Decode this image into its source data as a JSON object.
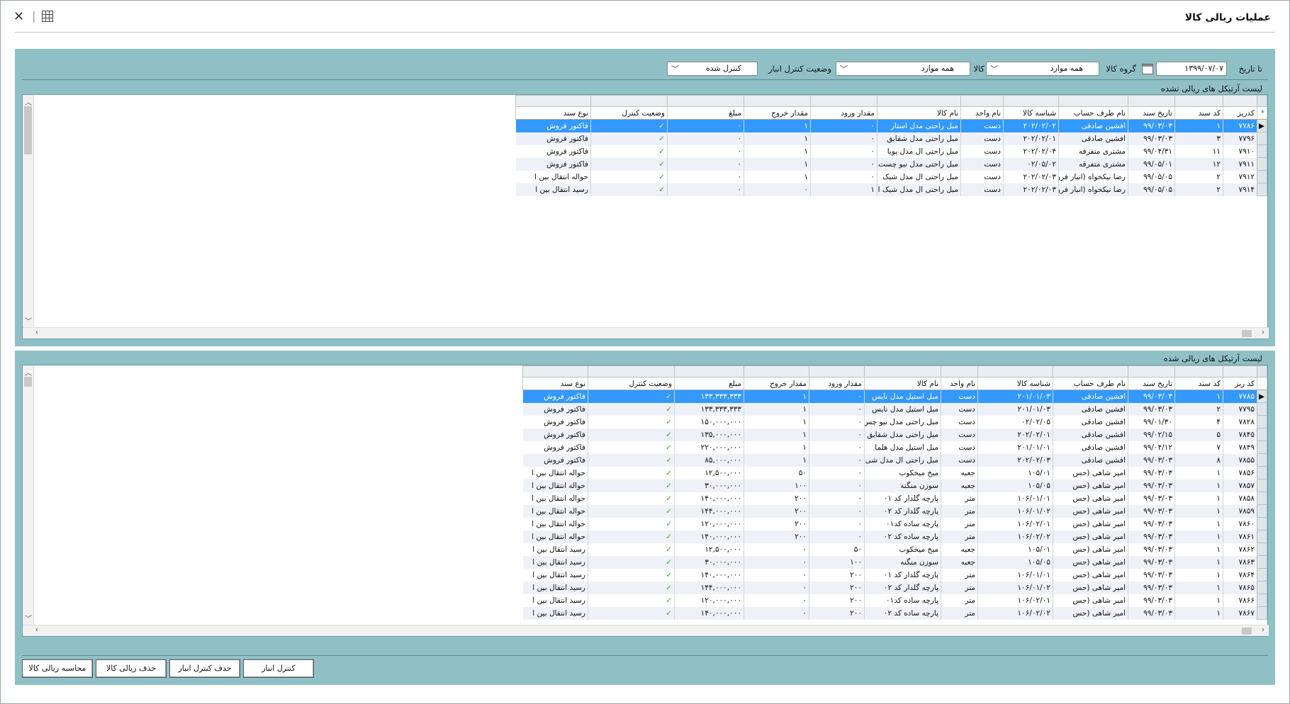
{
  "window": {
    "title": "عملیات ریالی کالا"
  },
  "filters": {
    "to_date_label": "تا تاریخ",
    "to_date_value": "۱۳۹۹/۰۷/۰۷",
    "group_label": "گروه کالا",
    "group_value": "همه موارد",
    "item_label": "کالا",
    "item_value": "همه موارد",
    "status_label": "وضعیت کنترل انبار",
    "status_value": "کنترل شده"
  },
  "top_grid": {
    "title": "لیست آرتیکل های ریالی نشده",
    "columns": [
      "کدریز",
      "کد سند",
      "تاریخ سند",
      "نام طرف حساب",
      "شناسه کالا",
      "نام واحد",
      "نام کالا",
      "مقدار ورود",
      "مقدار خروج",
      "مبلغ",
      "وضعیت کنترل",
      "نوع سند"
    ],
    "rows": [
      [
        "۷۷۸۶",
        "۱",
        "۹۹/۰۳/۰۳",
        "افشین صادقی",
        "۲۰۲/۰۲/۰۲",
        "دست",
        "مبل راحتی مدل استار",
        "۰",
        "۱",
        "۰",
        "✓",
        "فاکتور فروش"
      ],
      [
        "۷۷۹۶",
        "۳",
        "۹۹/۰۳/۰۳",
        "افشین صادقی",
        "۲۰۲/۰۲/۰۱",
        "دست",
        "مبل راحتی مدل شقایق",
        "۰",
        "۱",
        "۰",
        "✓",
        "فاکتور فروش"
      ],
      [
        "۷۹۱۰",
        "۱۱",
        "۹۹/۰۴/۳۱",
        "مشتری متفرقه",
        "۲۰۲/۰۲/۰۴",
        "دست",
        "مبل راحتی ال مدل پویا",
        "۰",
        "۱",
        "۰",
        "✓",
        "فاکتور فروش"
      ],
      [
        "۷۹۱۱",
        "۱۲",
        "۹۹/۰۵/۰۱",
        "مشتری متفرقه",
        "۰۲/۰۵/۰۲",
        "دست",
        "مبل راحتی مدل نیو چست",
        "۰",
        "۱",
        "۰",
        "✓",
        "فاکتور فروش"
      ],
      [
        "۷۹۱۲",
        "۲",
        "۹۹/۰۵/۰۵",
        "رضا نیکخواه (انبار فرو",
        "۲۰۲/۰۲/۰۳",
        "دست",
        "مبل راحتی ال مدل شیک",
        "۰",
        "۱",
        "۰",
        "✓",
        "حواله انتقال بین ا"
      ],
      [
        "۷۹۱۴",
        "۲",
        "۹۹/۰۵/۰۵",
        "رضا نیکخواه (انبار فرو",
        "۲۰۲/۰۲/۰۳",
        "دست",
        "مبل راحتی ال مدل شیک ا",
        "۱",
        "۰",
        "۰",
        "✓",
        "رسید انتقال بین ا"
      ]
    ]
  },
  "bottom_grid": {
    "title": "لیست آرتیکل های ریالی شده",
    "columns": [
      "کد ریز",
      "کد سند",
      "تاریخ سند",
      "نام طرف حساب",
      "شناسه کالا",
      "نام واحد",
      "نام کالا",
      "مقدار ورود",
      "مقدار خروج",
      "مبلغ",
      "وضعیت کنترل",
      "نوع سند"
    ],
    "rows": [
      [
        "۷۷۸۵",
        "۱",
        "۹۹/۰۳/۰۳",
        "افشین صادقی",
        "۲۰۱/۰۱/۰۳",
        "دست",
        "مبل استیل مدل نایس",
        "۰",
        "۱",
        "۱۳۳,۳۳۳,۳۳۳",
        "✓",
        "فاکتور فروش"
      ],
      [
        "۷۷۹۵",
        "۲",
        "۹۹/۰۳/۰۳",
        "افشین صادقی",
        "۲۰۱/۰۱/۰۳",
        "دست",
        "مبل استیل مدل نایس",
        "۰",
        "۱",
        "۱۳۳,۳۳۳,۳۳۳",
        "✓",
        "فاکتور فروش"
      ],
      [
        "۷۸۲۸",
        "۴",
        "۹۹/۰۱/۳۰",
        "افشین صادقی",
        "۰۲/۰۲/۰۵",
        "دست",
        "مبل راحتی مدل نیو چس",
        "۰",
        "۱",
        "۱۵۰,۰۰۰,۰۰۰",
        "✓",
        "فاکتور فروش"
      ],
      [
        "۷۸۴۵",
        "۵",
        "۹۹/۰۲/۱۵",
        "افشین صادقی",
        "۲۰۲/۰۲/۰۱",
        "دست",
        "مبل راحتی مدل شقایق",
        "۰",
        "۱",
        "۱۳۵,۰۰۰,۰۰۰",
        "✓",
        "فاکتور فروش"
      ],
      [
        "۷۸۴۹",
        "۷",
        "۹۹/۰۴/۱۲",
        "افشین صادقی",
        "۲۰۱/۰۱/۰۱",
        "دست",
        "مبل استیل مدل هلما",
        "۰",
        "۱",
        "۲۲۰,۰۰۰,۰۰۰",
        "✓",
        "فاکتور فروش"
      ],
      [
        "۷۸۵۵",
        "۸",
        "۹۹/۰۳/۰۳",
        "افشین صادقی",
        "۲۰۲/۰۲/۰۳",
        "دست",
        "مبل راحتی ال مدل شی",
        "۰",
        "۱",
        "۸۵,۰۰۰,۰۰۰",
        "✓",
        "فاکتور فروش"
      ],
      [
        "۷۸۵۶",
        "۱",
        "۹۹/۰۳/۰۳",
        "امیر شاهی (حس",
        "۱۰۵/۰۱",
        "جعبه",
        "میخ میخکوب",
        "۰",
        "۵۰",
        "۱۲,۵۰۰,۰۰۰",
        "✓",
        "حواله انتقال بین ا"
      ],
      [
        "۷۸۵۷",
        "۱",
        "۹۹/۰۳/۰۳",
        "امیر شاهی (حس",
        "۱۰۵/۰۵",
        "جعبه",
        "سوزن منگنه",
        "۰",
        "۱۰۰",
        "۳۰,۰۰۰,۰۰۰",
        "✓",
        "حواله انتقال بین ا"
      ],
      [
        "۷۸۵۸",
        "۱",
        "۹۹/۰۳/۰۳",
        "امیر شاهی (حس",
        "۱۰۶/۰۱/۰۱",
        "متر",
        "پارچه گلدار کد ۰۱",
        "۰",
        "۲۰۰",
        "۱۴۰,۰۰۰,۰۰۰",
        "✓",
        "حواله انتقال بین ا"
      ],
      [
        "۷۸۵۹",
        "۱",
        "۹۹/۰۳/۰۳",
        "امیر شاهی (حس",
        "۱۰۶/۰۱/۰۲",
        "متر",
        "پارچه گلدار کد ۰۲",
        "۰",
        "۲۰۰",
        "۱۴۴,۰۰۰,۰۰۰",
        "✓",
        "حواله انتقال بین ا"
      ],
      [
        "۷۸۶۰",
        "۱",
        "۹۹/۰۳/۰۳",
        "امیر شاهی (حس",
        "۱۰۶/۰۲/۰۱",
        "متر",
        "پارچه ساده کد۰۱",
        "۰",
        "۲۰۰",
        "۱۲۰,۰۰۰,۰۰۰",
        "✓",
        "حواله انتقال بین ا"
      ],
      [
        "۷۸۶۱",
        "۱",
        "۹۹/۰۳/۰۳",
        "امیر شاهی (حس",
        "۱۰۶/۰۲/۰۲",
        "متر",
        "پارچه ساده کد ۰۲",
        "۰",
        "۲۰۰",
        "۱۴۰,۰۰۰,۰۰۰",
        "✓",
        "حواله انتقال بین ا"
      ],
      [
        "۷۸۶۲",
        "۱",
        "۹۹/۰۳/۰۳",
        "امیر شاهی (حس",
        "۱۰۵/۰۱",
        "جعبه",
        "میخ میخکوب",
        "۵۰",
        "۰",
        "۱۲,۵۰۰,۰۰۰",
        "✓",
        "رسید انتقال بین ا"
      ],
      [
        "۷۸۶۳",
        "۱",
        "۹۹/۰۳/۰۳",
        "امیر شاهی (حس",
        "۱۰۵/۰۵",
        "جعبه",
        "سوزن منگنه",
        "۱۰۰",
        "۰",
        "۳۰,۰۰۰,۰۰۰",
        "✓",
        "رسید انتقال بین ا"
      ],
      [
        "۷۸۶۴",
        "۱",
        "۹۹/۰۳/۰۳",
        "امیر شاهی (حس",
        "۱۰۶/۰۱/۰۱",
        "متر",
        "پارچه گلدار کد ۰۱",
        "۲۰۰",
        "۰",
        "۱۴۰,۰۰۰,۰۰۰",
        "✓",
        "رسید انتقال بین ا"
      ],
      [
        "۷۸۶۵",
        "۱",
        "۹۹/۰۳/۰۳",
        "امیر شاهی (حس",
        "۱۰۶/۰۱/۰۲",
        "متر",
        "پارچه گلدار کد ۰۲",
        "۲۰۰",
        "۰",
        "۱۴۴,۰۰۰,۰۰۰",
        "✓",
        "رسید انتقال بین ا"
      ],
      [
        "۷۸۶۶",
        "۱",
        "۹۹/۰۳/۰۳",
        "امیر شاهی (حس",
        "۱۰۶/۰۲/۰۱",
        "متر",
        "پارچه ساده کد۰۱",
        "۲۰۰",
        "۰",
        "۱۲۰,۰۰۰,۰۰۰",
        "✓",
        "رسید انتقال بین ا"
      ],
      [
        "۷۸۶۷",
        "۱",
        "۹۹/۰۳/۰۳",
        "امیر شاهی (حس",
        "۱۰۶/۰۲/۰۲",
        "متر",
        "پارچه ساده کد ۰۲",
        "۲۰۰",
        "۰",
        "۱۴۰,۰۰۰,۰۰۰",
        "✓",
        "رسید انتقال بین ا"
      ]
    ]
  },
  "buttons": {
    "stock_control": "کنترل انبار",
    "delete_stock_control": "حذف کنترل انبار",
    "delete_rial": "حذف ریالی کالا",
    "calc_rial": "محاسبه ریالی کالا"
  },
  "icons": {
    "close": "close-icon",
    "grid": "grid-icon",
    "calendar": "calendar-icon",
    "check": "check-icon"
  },
  "colors": {
    "panel": "#8fc0c6",
    "selected_row": "#3399ff",
    "check": "#4a9a2e"
  }
}
